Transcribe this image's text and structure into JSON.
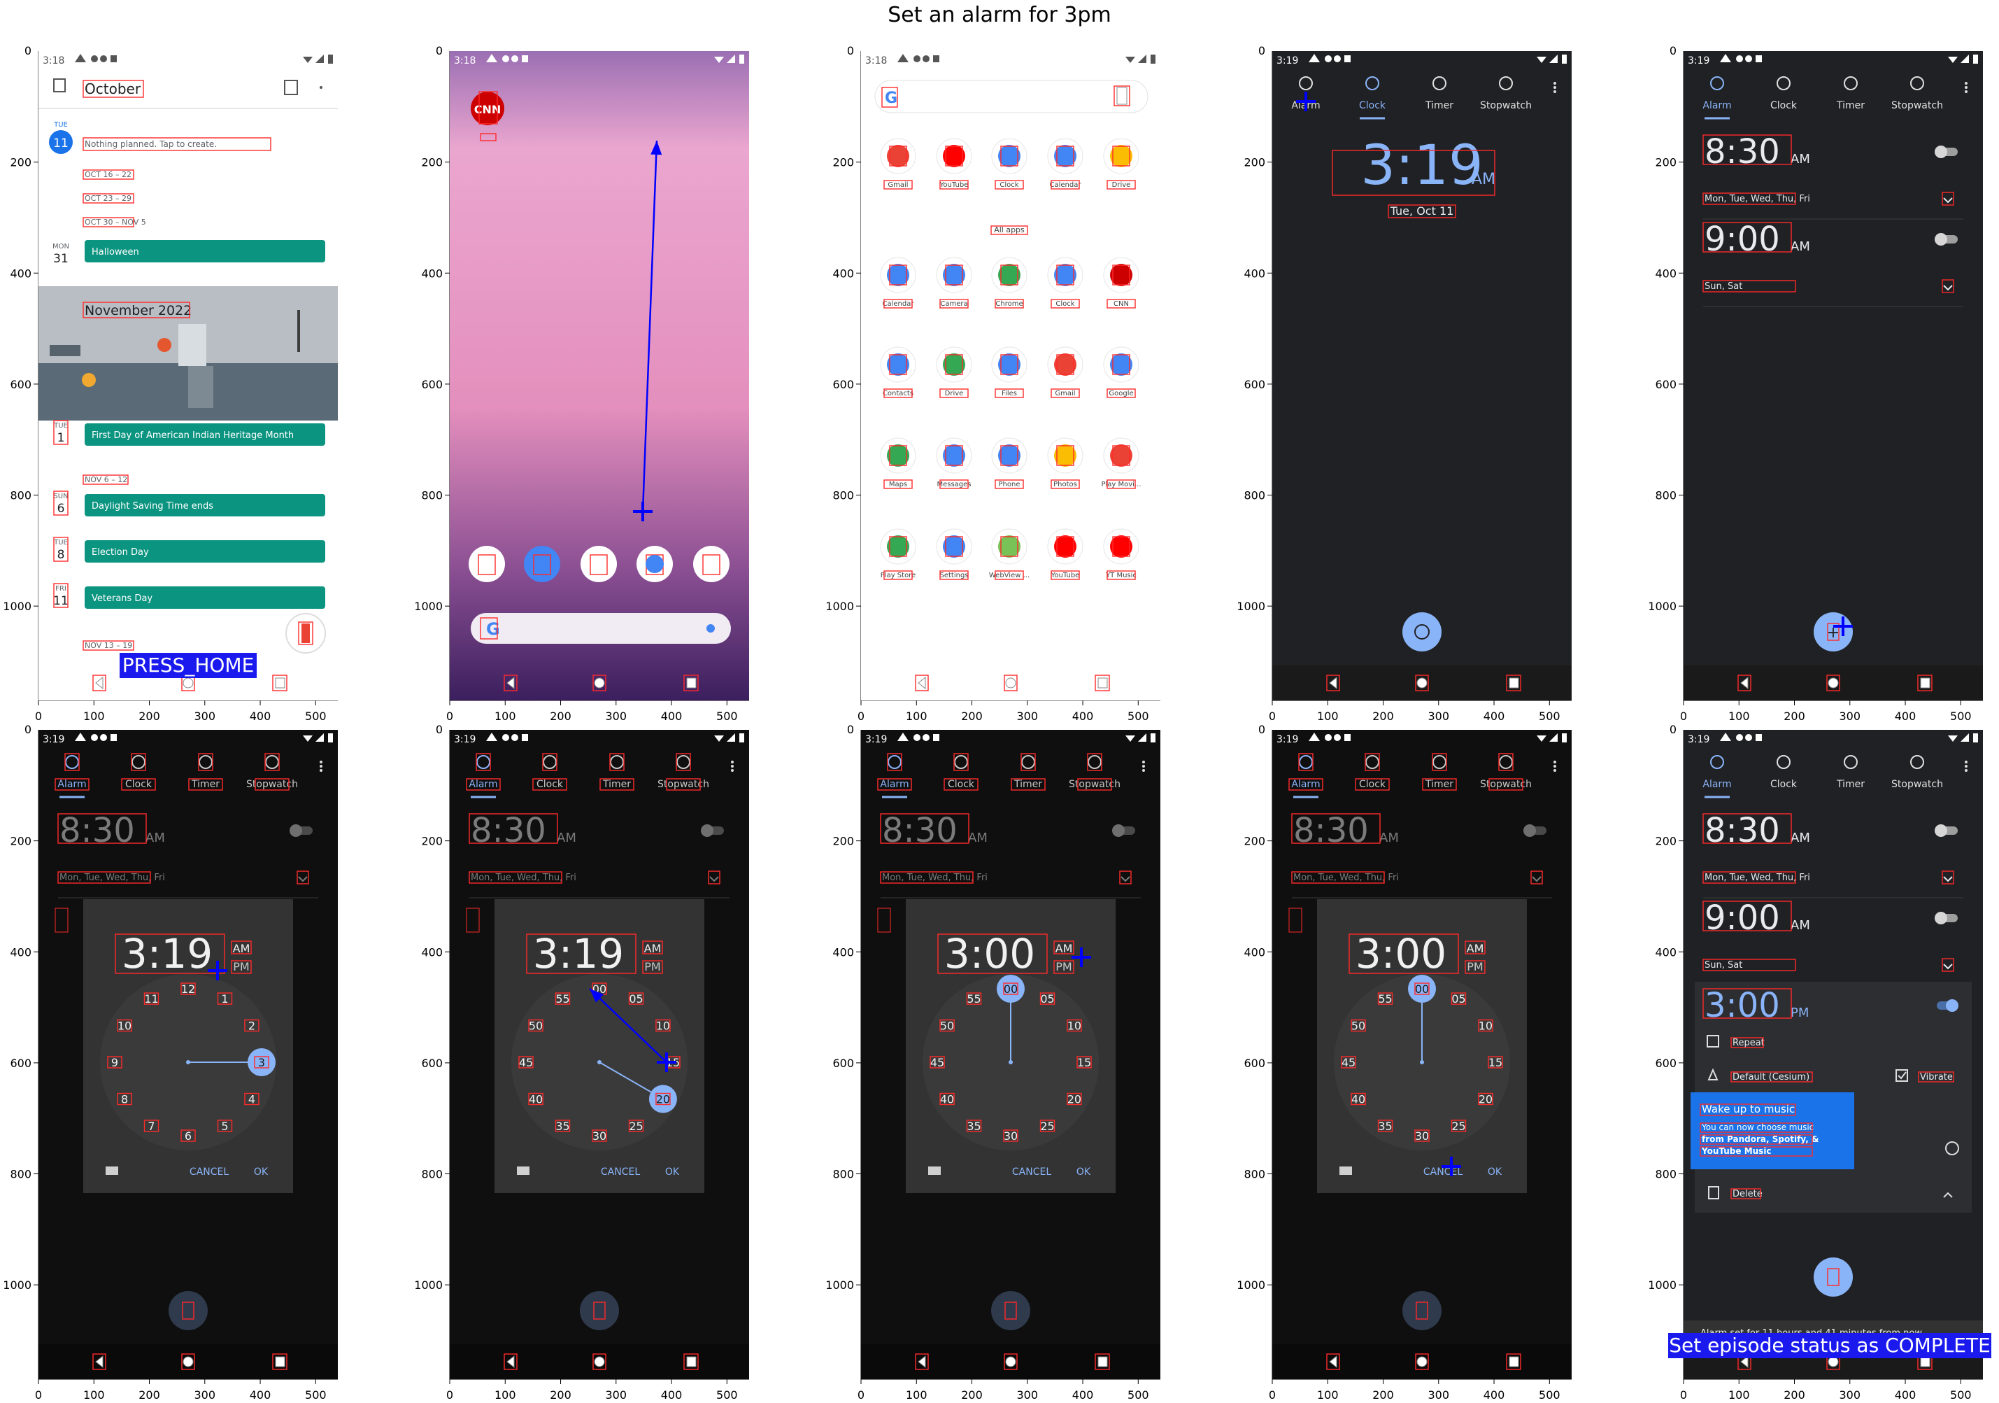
{
  "figure": {
    "title": "Set an alarm for 3pm",
    "x_ticks": [
      "0",
      "100",
      "200",
      "300",
      "400",
      "500"
    ],
    "y_ticks": [
      "0",
      "200",
      "400",
      "600",
      "800",
      "1000"
    ]
  },
  "colors": {
    "annotation_box": "#ff2a2a",
    "action_marker": "#0000ff",
    "overlay_label_bg": "#1a1aee",
    "overlay_label_text": "#ffffff",
    "calendar_teal": "#0b9480",
    "google_blue": "#1a73e8",
    "clock_dark_bg": "#202124",
    "clock_accent": "#8ab4f8"
  },
  "steps": [
    {
      "app": "calendar",
      "time": "3:18",
      "header": {
        "month": "October"
      },
      "day_badge": {
        "dow": "TUE",
        "day": "11"
      },
      "empty_text": "Nothing planned. Tap to create.",
      "ranges": [
        "OCT 16 – 22",
        "OCT 23 – 29",
        "OCT 30 – NOV 5"
      ],
      "halloween": {
        "dow": "MON",
        "day": "31",
        "title": "Halloween"
      },
      "month_banner": "November 2022",
      "events": [
        {
          "dow": "TUE",
          "day": "1",
          "title": "First Day of American Indian Heritage Month"
        },
        {
          "dow": "SUN",
          "day": "6",
          "title": "Daylight Saving Time ends"
        },
        {
          "dow": "TUE",
          "day": "8",
          "title": "Election Day"
        },
        {
          "dow": "FRI",
          "day": "11",
          "title": "Veterans Day"
        }
      ],
      "range_mid": "NOV 6 – 12",
      "range_low": "NOV 13 – 19",
      "action_label": "PRESS_HOME"
    },
    {
      "app": "home",
      "time": "3:18",
      "cnn_label": "CNN",
      "dock_icons": [
        "play-store-icon",
        "messages-icon",
        "maps-icon",
        "chrome-icon",
        "photos-icon"
      ]
    },
    {
      "app": "drawer",
      "time": "3:18",
      "all_apps": "All apps",
      "apps": [
        [
          "Gmail",
          "YouTube",
          "Clock",
          "Calendar",
          "Drive"
        ],
        [
          "Calendar",
          "Camera",
          "Chrome",
          "Clock",
          "CNN"
        ],
        [
          "Contacts",
          "Drive",
          "Files",
          "Gmail",
          "Google"
        ],
        [
          "Maps",
          "Messages",
          "Phone",
          "Photos",
          "Play Movi..."
        ],
        [
          "Play Store",
          "Settings",
          "WebView ...",
          "YouTube",
          "YT Music"
        ]
      ]
    },
    {
      "app": "clock",
      "time": "3:19",
      "tabs": [
        "Alarm",
        "Clock",
        "Timer",
        "Stopwatch"
      ],
      "big_time": "3:19",
      "ampm": "AM",
      "date": "Tue, Oct 11"
    },
    {
      "app": "alarm_list",
      "time": "3:19",
      "tabs": [
        "Alarm",
        "Clock",
        "Timer",
        "Stopwatch"
      ],
      "alarms": [
        {
          "time": "8:30",
          "ampm": "AM",
          "days": "Mon, Tue, Wed, Thu, Fri"
        },
        {
          "time": "9:00",
          "ampm": "AM",
          "days": "Sun, Sat"
        }
      ]
    },
    {
      "app": "picker_hours",
      "time": "3:19",
      "tabs": [
        "Alarm",
        "Clock",
        "Timer",
        "Stopwatch"
      ],
      "bg_alarms": [
        {
          "time": "8:30",
          "ampm": "AM",
          "days": "Mon, Tue, Wed, Thu, Fri"
        }
      ],
      "picker_time": "3:19",
      "am": "AM",
      "pm": "PM",
      "dial": [
        "12",
        "1",
        "2",
        "3",
        "4",
        "5",
        "6",
        "7",
        "8",
        "9",
        "10",
        "11"
      ],
      "selected": "3",
      "cancel": "CANCEL",
      "ok": "OK"
    },
    {
      "app": "picker_minutes",
      "time": "3:19",
      "tabs": [
        "Alarm",
        "Clock",
        "Timer",
        "Stopwatch"
      ],
      "bg_alarms": [
        {
          "time": "8:30",
          "ampm": "AM",
          "days": "Mon, Tue, Wed, Thu, Fri"
        }
      ],
      "picker_time": "3:19",
      "am": "AM",
      "pm": "PM",
      "dial": [
        "00",
        "05",
        "10",
        "15",
        "20",
        "25",
        "30",
        "35",
        "40",
        "45",
        "50",
        "55"
      ],
      "selected": "20",
      "cancel": "CANCEL",
      "ok": "OK"
    },
    {
      "app": "picker_minutes",
      "time": "3:19",
      "tabs": [
        "Alarm",
        "Clock",
        "Timer",
        "Stopwatch"
      ],
      "bg_alarms": [
        {
          "time": "8:30",
          "ampm": "AM",
          "days": "Mon, Tue, Wed, Thu, Fri"
        }
      ],
      "picker_time": "3:00",
      "am": "AM",
      "pm": "PM",
      "dial": [
        "00",
        "05",
        "10",
        "15",
        "20",
        "25",
        "30",
        "35",
        "40",
        "45",
        "50",
        "55"
      ],
      "selected": "00",
      "cancel": "CANCEL",
      "ok": "OK"
    },
    {
      "app": "picker_minutes",
      "time": "3:19",
      "tabs": [
        "Alarm",
        "Clock",
        "Timer",
        "Stopwatch"
      ],
      "bg_alarms": [
        {
          "time": "8:30",
          "ampm": "AM",
          "days": "Mon, Tue, Wed, Thu, Fri"
        }
      ],
      "picker_time": "3:00",
      "am": "AM",
      "pm": "PM",
      "dial": [
        "00",
        "05",
        "10",
        "15",
        "20",
        "25",
        "30",
        "35",
        "40",
        "45",
        "50",
        "55"
      ],
      "selected": "00",
      "cancel": "CANCEL",
      "ok": "OK"
    },
    {
      "app": "alarm_set",
      "time": "3:19",
      "tabs": [
        "Alarm",
        "Clock",
        "Timer",
        "Stopwatch"
      ],
      "alarms": [
        {
          "time": "8:30",
          "ampm": "AM",
          "days": "Mon, Tue, Wed, Thu, Fri"
        },
        {
          "time": "9:00",
          "ampm": "AM",
          "days": "Sun, Sat"
        }
      ],
      "new_alarm": {
        "time": "3:00",
        "ampm": "PM"
      },
      "repeat": "Repeat",
      "ringtone": "Default (Cesium)",
      "vibrate": "Vibrate",
      "tooltip_title": "Wake up to music",
      "tooltip_body": [
        "You can now choose music",
        "from Pandora, Spotify, &",
        "YouTube Music"
      ],
      "delete": "Delete",
      "snackbar": "Alarm set for 11 hours and 41 minutes from now.",
      "action_label": "Set episode status as COMPLETE"
    }
  ]
}
